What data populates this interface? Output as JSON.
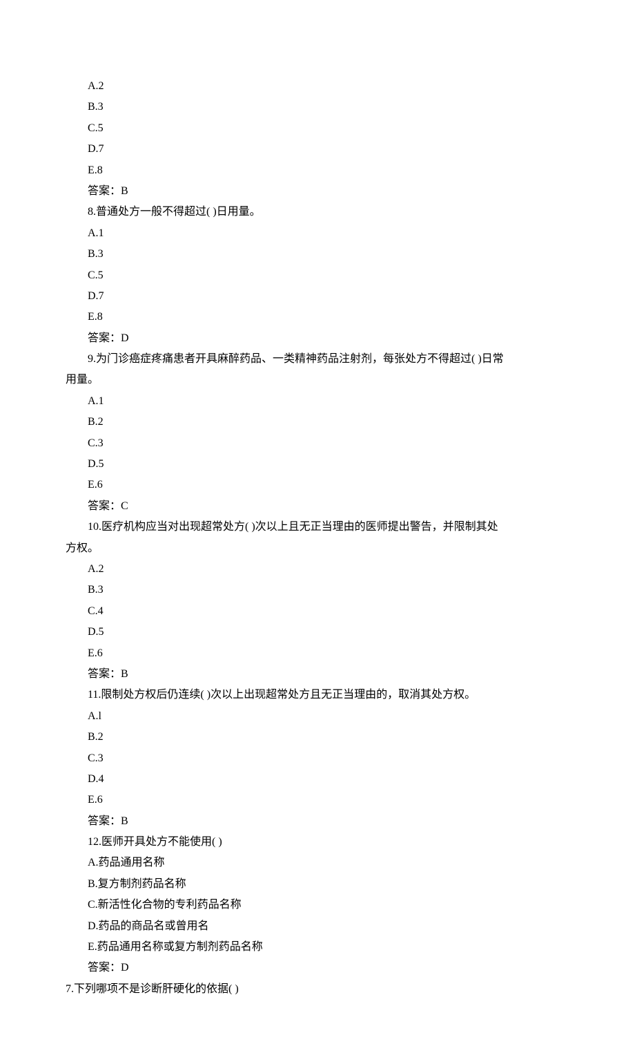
{
  "q7_continued": {
    "options": [
      "A.2",
      "B.3",
      "C.5",
      "D.7",
      "E.8"
    ],
    "answer": "答案：B"
  },
  "q8": {
    "stem": "8.普通处方一般不得超过(  )日用量。",
    "options": [
      "A.1",
      "B.3",
      "C.5",
      "D.7",
      "E.8"
    ],
    "answer": "答案：D"
  },
  "q9": {
    "stem_line1": "9.为门诊癌症疼痛患者开具麻醉药品、一类精神药品注射剂，每张处方不得超过(  )日常",
    "stem_line2": "用量。",
    "options": [
      "A.1",
      "B.2",
      "C.3",
      "D.5",
      "E.6"
    ],
    "answer": "答案：C"
  },
  "q10": {
    "stem_line1": "10.医疗机构应当对出现超常处方(  )次以上且无正当理由的医师提出警告，并限制其处",
    "stem_line2": "方权。",
    "options": [
      "A.2",
      "B.3",
      "C.4",
      "D.5",
      "E.6"
    ],
    "answer": "答案：B"
  },
  "q11": {
    "stem": "11.限制处方权后仍连续(  )次以上出现超常处方且无正当理由的，取消其处方权。",
    "options": [
      "A.l",
      "B.2",
      "C.3",
      "D.4",
      "E.6"
    ],
    "answer": "答案：B"
  },
  "q12": {
    "stem": "12.医师开具处方不能使用(  )",
    "options": [
      "A.药品通用名称",
      "B.复方制剂药品名称",
      "C.新活性化合物的专利药品名称",
      "D.药品的商品名或曾用名",
      "E.药品通用名称或复方制剂药品名称"
    ],
    "answer": "答案：D"
  },
  "q7_new": {
    "stem": "7.下列哪项不是诊断肝硬化的依据(    )"
  }
}
